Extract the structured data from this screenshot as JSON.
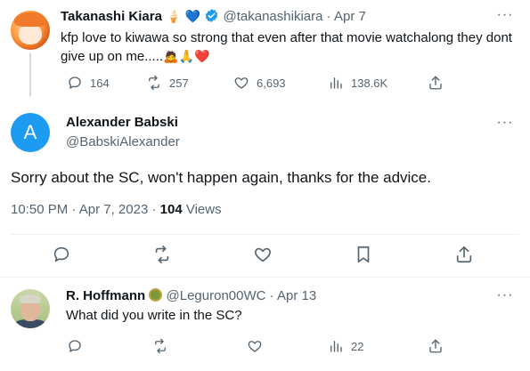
{
  "thread_parent": {
    "name": "Takanashi Kiara",
    "name_emoji": "🍦",
    "heart_emoji": "💙",
    "handle": "@takanashikiara",
    "separator": "·",
    "date": "Apr 7",
    "text": "kfp love to kiwawa so strong that even after that movie watchalong they dont give up on me.....",
    "text_emojis": "🙇🙏❤️",
    "more": "···",
    "replies": "164",
    "retweets": "257",
    "likes": "6,693",
    "views": "138.6K"
  },
  "focal_tweet": {
    "avatar_letter": "A",
    "name": "Alexander Babski",
    "handle": "@BabskiAlexander",
    "more": "···",
    "text": "Sorry about the SC, won't happen again, thanks for the advice.",
    "time": "10:50 PM",
    "separator": "·",
    "date": "Apr 7, 2023",
    "separator2": "·",
    "views_count": "104",
    "views_label": "Views"
  },
  "reply": {
    "name": "R. Hoffmann",
    "handle": "@Leguron00WC",
    "separator": "·",
    "date": "Apr 13",
    "more": "···",
    "text": "What did you write in the SC?",
    "views": "22"
  },
  "colors": {
    "accent": "#1d9bf0",
    "muted": "#536471",
    "text": "#0f1419",
    "divider": "#eff3f4",
    "thread_line": "#cfd9de"
  },
  "icons": {
    "reply": "reply-icon",
    "retweet": "retweet-icon",
    "like": "heart-icon",
    "views": "views-icon",
    "share": "share-icon",
    "bookmark": "bookmark-icon",
    "more": "more-icon",
    "verified": "verified-badge-icon"
  }
}
